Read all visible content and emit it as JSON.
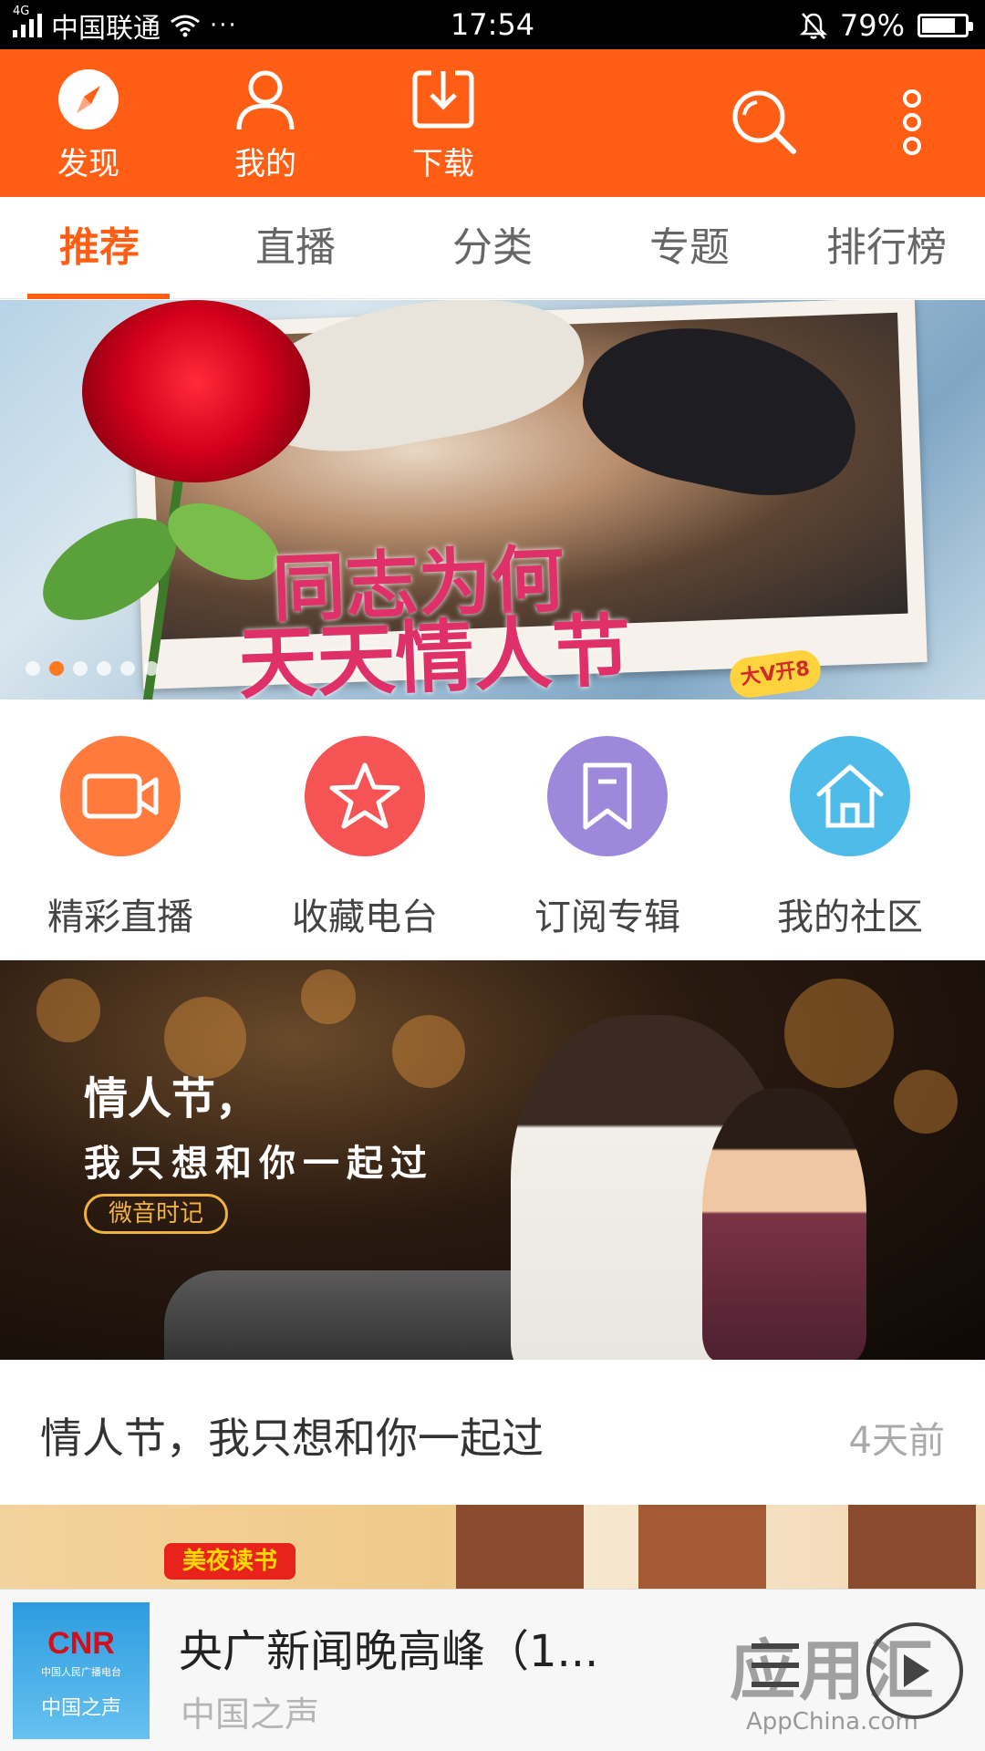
{
  "status_bar": {
    "network": "4G",
    "carrier": "中国联通",
    "dots": "···",
    "time": "17:54",
    "battery": "79%",
    "battery_level": 0.79
  },
  "topbar": {
    "items": [
      {
        "label": "发现",
        "icon": "compass-icon"
      },
      {
        "label": "我的",
        "icon": "person-icon"
      },
      {
        "label": "下载",
        "icon": "download-icon"
      }
    ],
    "search_icon": "search-icon",
    "more_icon": "more-vertical-icon",
    "color": "#ff5e14"
  },
  "tabs": [
    {
      "label": "推荐",
      "active": true
    },
    {
      "label": "直播",
      "active": false
    },
    {
      "label": "分类",
      "active": false
    },
    {
      "label": "专题",
      "active": false
    },
    {
      "label": "排行榜",
      "active": false
    }
  ],
  "banner1": {
    "title_line1": "同志为何",
    "title_line2": "天天情人节",
    "badge": "大V开8",
    "dots_total": 6,
    "dots_active": 2
  },
  "quick_entries": [
    {
      "label": "精彩直播",
      "icon": "video-camera-icon",
      "color": "#ff7a3d"
    },
    {
      "label": "收藏电台",
      "icon": "star-icon",
      "color": "#f65454"
    },
    {
      "label": "订阅专辑",
      "icon": "bookmark-icon",
      "color": "#9d88dc"
    },
    {
      "label": "我的社区",
      "icon": "home-icon",
      "color": "#4ebbe9"
    }
  ],
  "banner2": {
    "line1": "情人节，",
    "line2": "我只想和你一起过",
    "tag": "微音时记"
  },
  "article": {
    "title": "情人节，我只想和你一起过",
    "time": "4天前"
  },
  "banner3": {
    "tag": "美夜读书"
  },
  "player": {
    "cover_logo": "CNR",
    "cover_subtitle": "中国人民广播电台",
    "cover_name": "中国之声",
    "title": "央广新闻晚高峰（1...",
    "subtitle": "中国之声",
    "watermark": "应用汇",
    "watermark_en": "AppChina.com"
  }
}
